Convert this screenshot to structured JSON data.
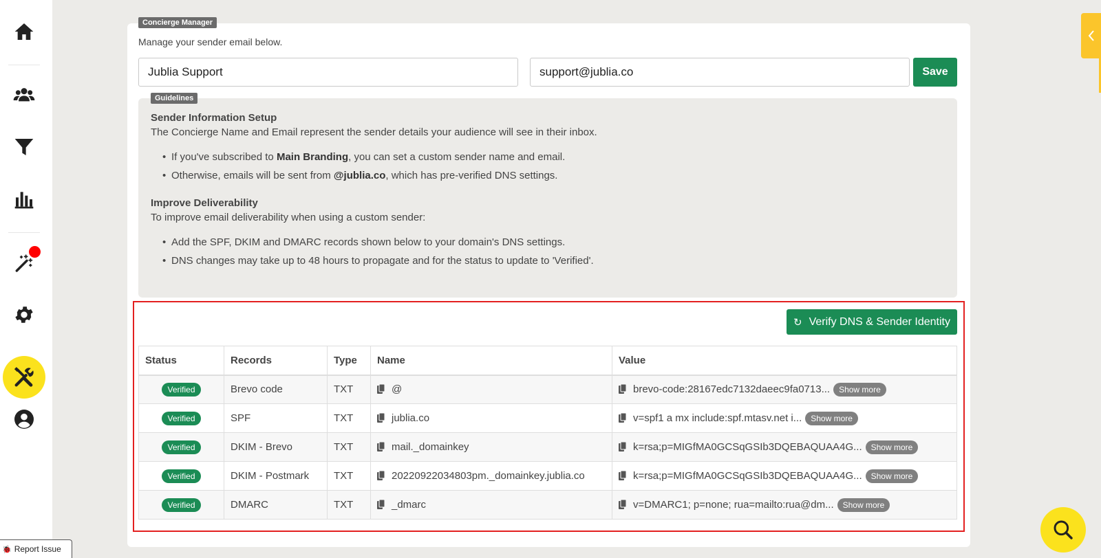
{
  "sidebar": {
    "items": [
      {
        "icon": "home-icon"
      },
      {
        "icon": "users-icon"
      },
      {
        "icon": "funnel-icon"
      },
      {
        "icon": "bar-chart-icon"
      },
      {
        "icon": "magic-wand-icon"
      },
      {
        "icon": "gear-icon"
      },
      {
        "icon": "tools-icon",
        "active": true
      },
      {
        "icon": "user-circle-icon"
      }
    ],
    "active_color": "#fbe21d",
    "notification_color": "#ff0000"
  },
  "report_issue": {
    "label": "Report Issue"
  },
  "concierge": {
    "tag": "Concierge Manager",
    "subtitle": "Manage your sender email below.",
    "sender_name": "Jublia Support",
    "sender_email": "support@jublia.co",
    "save_label": "Save"
  },
  "guidelines": {
    "tag": "Guidelines",
    "section1_title": "Sender Information Setup",
    "section1_text": "The Concierge Name and Email represent the sender details your audience will see in their inbox.",
    "bullet1_pre": "If you've subscribed to ",
    "bullet1_bold": "Main Branding",
    "bullet1_post": ", you can set a custom sender name and email.",
    "bullet2_pre": "Otherwise, emails will be sent from ",
    "bullet2_bold": "@jublia.co",
    "bullet2_post": ", which has pre-verified DNS settings.",
    "section2_title": "Improve Deliverability",
    "section2_text": "To improve email deliverability when using a custom sender:",
    "bullet3": "Add the SPF, DKIM and DMARC records shown below to your domain's DNS settings.",
    "bullet4": "DNS changes may take up to 48 hours to propagate and for the status to update to 'Verified'."
  },
  "verify": {
    "label": "Verify DNS & Sender Identity"
  },
  "dns_table": {
    "headers": {
      "status": "Status",
      "records": "Records",
      "type": "Type",
      "name": "Name",
      "value": "Value"
    },
    "show_more_label": "Show more",
    "rows": [
      {
        "status": "Verified",
        "record": "Brevo code",
        "type": "TXT",
        "name": "@",
        "value": "brevo-code:28167edc7132daeec9fa0713..."
      },
      {
        "status": "Verified",
        "record": "SPF",
        "type": "TXT",
        "name": "jublia.co",
        "value": "v=spf1 a mx include:spf.mtasv.net i..."
      },
      {
        "status": "Verified",
        "record": "DKIM - Brevo",
        "type": "TXT",
        "name": "mail._domainkey",
        "value": "k=rsa;p=MIGfMA0GCSqGSIb3DQEBAQUAA4G..."
      },
      {
        "status": "Verified",
        "record": "DKIM - Postmark",
        "type": "TXT",
        "name": "20220922034803pm._domainkey.jublia.co",
        "value": "k=rsa;p=MIGfMA0GCSqGSIb3DQEBAQUAA4G..."
      },
      {
        "status": "Verified",
        "record": "DMARC",
        "type": "TXT",
        "name": "_dmarc",
        "value": "v=DMARC1; p=none; rua=mailto:rua@dm..."
      }
    ]
  },
  "colors": {
    "primary_green": "#1b8c55",
    "highlight_red": "#e31f1f",
    "accent_yellow": "#fbe21d"
  },
  "fab": {
    "icon": "search-icon"
  },
  "side_tab": {
    "icon": "chevron-left-icon"
  }
}
